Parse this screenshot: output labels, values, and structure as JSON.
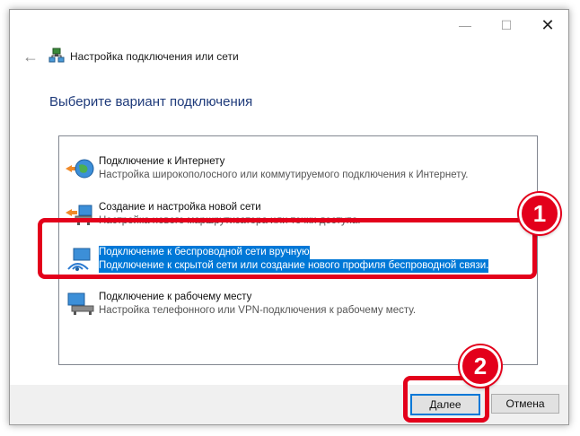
{
  "window": {
    "title": "Настройка подключения или сети",
    "minimize_glyph": "—",
    "maximize_glyph": "☐",
    "close_glyph": "✕",
    "back_glyph": "←"
  },
  "heading": "Выберите вариант подключения",
  "options": [
    {
      "title": "Подключение к Интернету",
      "desc": "Настройка широкополосного или коммутируемого подключения к Интернету.",
      "icon": "internet-globe-icon",
      "selected": false
    },
    {
      "title": "Создание и настройка новой сети",
      "desc": "Настройка нового маршрутизатора или точки доступа.",
      "icon": "new-network-icon",
      "selected": false
    },
    {
      "title": "Подключение к беспроводной сети вручную",
      "desc": "Подключение к скрытой сети или создание нового профиля беспроводной связи.",
      "icon": "wireless-network-icon",
      "selected": true
    },
    {
      "title": "Подключение к рабочему месту",
      "desc": "Настройка телефонного или VPN-подключения к рабочему месту.",
      "icon": "workplace-network-icon",
      "selected": false
    }
  ],
  "buttons": {
    "next": "Далее",
    "cancel": "Отмена"
  },
  "callouts": {
    "step1": "1",
    "step2": "2"
  },
  "colors": {
    "selection": "#0078d7",
    "callout": "#e3001b",
    "heading": "#1e3a7a"
  }
}
